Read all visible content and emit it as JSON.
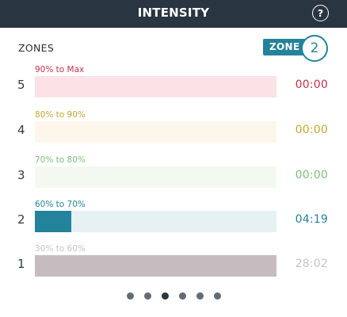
{
  "header": {
    "title": "INTENSITY",
    "help_icon": "?"
  },
  "zones_label": "ZONES",
  "current_zone": {
    "label": "ZONE",
    "value": "2"
  },
  "zones": [
    {
      "number": "5",
      "range": "90% to Max",
      "time": "00:00",
      "fill_fraction": 0,
      "color": "#c0334b",
      "bar_bg": "#fbe2e7",
      "fill_color": "#c0334b"
    },
    {
      "number": "4",
      "range": "80% to 90%",
      "time": "00:00",
      "fill_fraction": 0,
      "color": "#bfa831",
      "bar_bg": "#fcf7ea",
      "fill_color": "#bfa831"
    },
    {
      "number": "3",
      "range": "70% to 80%",
      "time": "00:00",
      "fill_fraction": 0,
      "color": "#7cc076",
      "bar_bg": "#f3f9f0",
      "fill_color": "#7cc076"
    },
    {
      "number": "2",
      "range": "60% to 70%",
      "time": "04:19",
      "fill_fraction": 0.15,
      "color": "#23839a",
      "bar_bg": "#e6f1f4",
      "fill_color": "#23839a"
    },
    {
      "number": "1",
      "range": "30% to 60%",
      "time": "28:02",
      "fill_fraction": 1,
      "color": "#c2c4c6",
      "bar_bg": "#c6bcbf",
      "fill_color": "#c6bcbf"
    }
  ],
  "pagination": {
    "count": 6,
    "active_index": 2
  }
}
